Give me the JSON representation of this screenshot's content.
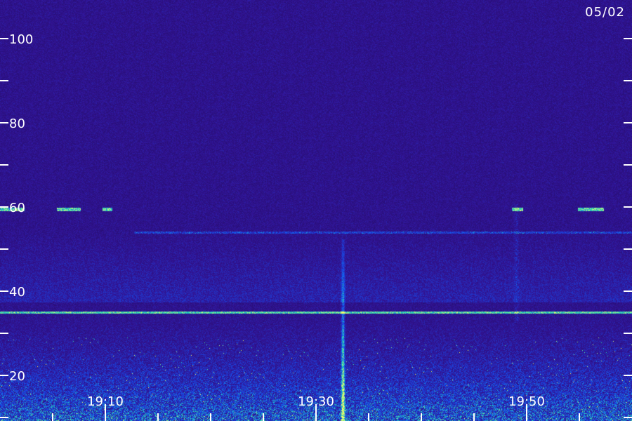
{
  "chart_data": {
    "type": "heatmap",
    "date_label": "05/02",
    "y_axis": {
      "range": [
        15,
        110
      ],
      "major_ticks": [
        20,
        40,
        60,
        80,
        100
      ],
      "tick_labels": [
        "20",
        "40",
        "60",
        "80",
        "100"
      ],
      "minor_ticks": [
        30,
        50,
        70,
        90
      ]
    },
    "x_axis": {
      "range_minutes": [
        19.0333,
        20.0333
      ],
      "major_tick_times": [
        "19:10",
        "19:30",
        "19:50"
      ],
      "major_tick_minutes": [
        1150,
        1170,
        1190
      ],
      "minor_tick_minutes": [
        1145,
        1155,
        1160,
        1165,
        1175,
        1180,
        1185,
        1195,
        1200
      ],
      "start_minute": 1142,
      "end_minute": 1202
    },
    "features": [
      {
        "name": "horizontal line",
        "y": 35
      },
      {
        "name": "horizontal line",
        "y": 54
      },
      {
        "name": "vertical streak",
        "time": "19:30"
      },
      {
        "name": "vertical streak",
        "time": "19:50"
      }
    ],
    "colors": {
      "background": "#2c1379",
      "low": "#1a0a55",
      "mid": "#1f3fd6",
      "high": "#34e0b0",
      "peak": "#ffff60"
    }
  }
}
